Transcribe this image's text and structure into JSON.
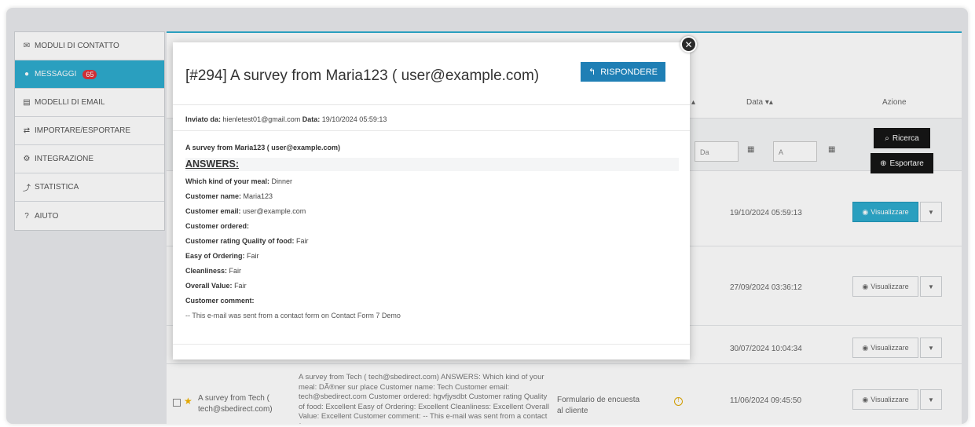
{
  "sidebar": {
    "items": [
      {
        "label": "MODULI DI CONTATTO",
        "icon": "envelope-icon"
      },
      {
        "label": "MESSAGGI",
        "icon": "chat-icon",
        "badge": "65"
      },
      {
        "label": "MODELLI DI EMAIL",
        "icon": "file-icon"
      },
      {
        "label": "IMPORTARE/ESPORTARE",
        "icon": "swap-icon"
      },
      {
        "label": "INTEGRAZIONE",
        "icon": "gears-icon"
      },
      {
        "label": "STATISTICA",
        "icon": "chart-icon"
      },
      {
        "label": "AIUTO",
        "icon": "question-icon"
      }
    ]
  },
  "table": {
    "headers": {
      "date": "Data ▾▴",
      "action": "Azione",
      "sort_fragment": "▴"
    },
    "filters": {
      "from_placeholder": "Da",
      "to_placeholder": "A",
      "search_label": "Ricerca",
      "export_label": "Esportare"
    },
    "rows": [
      {
        "date": "19/10/2024 05:59:13",
        "view_label": "Visualizzare",
        "primary": true
      },
      {
        "date": "27/09/2024 03:36:12",
        "view_label": "Visualizzare",
        "primary": false
      },
      {
        "date": "30/07/2024 10:04:34",
        "view_label": "Visualizzare",
        "primary": false
      },
      {
        "date": "11/06/2024 09:45:50",
        "view_label": "Visualizzare",
        "subject": "A survey from Tech ( tech@sbedirect.com)",
        "excerpt": "A survey from Tech ( tech@sbedirect.com) ANSWERS: Which kind of your meal: DÃ®ner sur place Customer name: Tech Customer email: tech@sbedirect.com Customer ordered: hgvfjysdbt Customer rating Quality of food: Excellent Easy of Ordering: Excellent Cleanliness: Excellent Overall Value: Excellent Customer comment: -- This e-mail was sent from a contact form...",
        "form": "Formulario de encuesta al cliente"
      }
    ]
  },
  "modal": {
    "title": "[#294] A survey from Maria123 ( user@example.com)",
    "reply_label": "RISPONDERE",
    "sent_by_label": "Inviato da:",
    "sent_by_value": "hienletest01@gmail.com",
    "date_label": "Data:",
    "date_value": "19/10/2024 05:59:13",
    "subject": "A survey from Maria123 ( user@example.com)",
    "answers_heading": "ANSWERS:",
    "answers": [
      {
        "q": "Which kind of your meal:",
        "a": "Dinner"
      },
      {
        "q": "Customer name:",
        "a": "Maria123"
      },
      {
        "q": "Customer email:",
        "a": "user@example.com"
      },
      {
        "q": "Customer ordered:",
        "a": ""
      },
      {
        "q": "Customer rating Quality of food:",
        "a": "Fair"
      },
      {
        "q": "Easy of Ordering:",
        "a": "Fair"
      },
      {
        "q": "Cleanliness:",
        "a": "Fair"
      },
      {
        "q": "Overall Value:",
        "a": "Fair"
      },
      {
        "q": "Customer comment:",
        "a": ""
      }
    ],
    "footer_note": "-- This e-mail was sent from a contact form on Contact Form 7 Demo"
  },
  "colors": {
    "accent": "#2eacce",
    "reply": "#1f7fb5",
    "badge": "#e0323a"
  }
}
